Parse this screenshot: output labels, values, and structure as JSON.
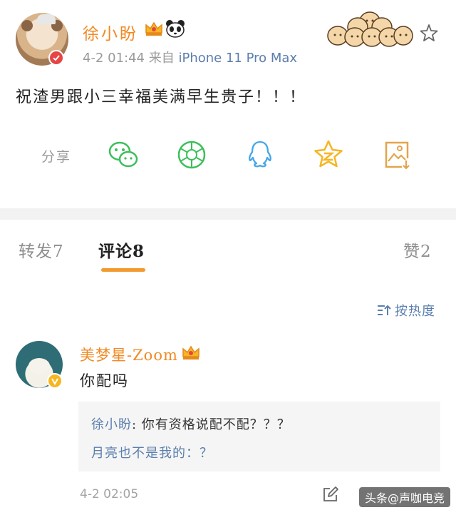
{
  "post": {
    "username": "徐小盼",
    "time": "4-2 01:44",
    "from_label": "来自",
    "device": "iPhone 11 Pro Max",
    "text": "祝渣男跟小三幸福美满早生贵子！！！"
  },
  "share": {
    "label": "分享",
    "icons": [
      "wechat-icon",
      "moments-icon",
      "qq-icon",
      "qzone-icon",
      "save-image-icon"
    ]
  },
  "tabs": {
    "repost": "转发7",
    "comment": "评论8",
    "like": "赞2"
  },
  "sort": {
    "label": "按热度"
  },
  "comment": {
    "username": "美梦星-Zoom",
    "text": "你配吗",
    "replies": [
      {
        "author": "徐小盼",
        "text": ": 你有资格说配不配？？？"
      },
      {
        "text": "月亮也不是我的：？"
      }
    ],
    "time": "4-2 02:05"
  },
  "watermark": "头条@声咖电竞",
  "colors": {
    "username": "#f08a24",
    "link": "#5b7fad",
    "tab_underline": "#f29a2e",
    "wechat": "#3cbf5a",
    "qq": "#45a6e8",
    "qzone": "#f6b623",
    "save": "#e2a54b"
  }
}
